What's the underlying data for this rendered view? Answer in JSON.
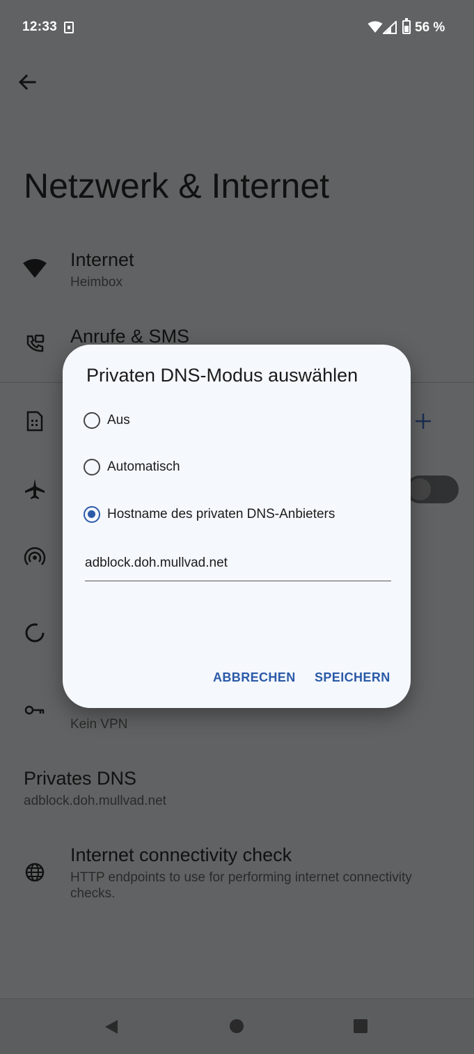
{
  "status_bar": {
    "time": "12:33",
    "battery": "56 %"
  },
  "page": {
    "title": "Netzwerk & Internet"
  },
  "settings": {
    "internet": {
      "title": "Internet",
      "subtitle": "Heimbox"
    },
    "calls": {
      "title": "Anrufe & SMS"
    },
    "vpn": {
      "subtitle": "Kein VPN"
    },
    "private_dns": {
      "title": "Privates DNS",
      "subtitle": "adblock.doh.mullvad.net"
    },
    "connectivity": {
      "title": "Internet connectivity check",
      "subtitle_line1": "HTTP endpoints to use for performing internet connectivity",
      "subtitle_line2": "checks."
    }
  },
  "dialog": {
    "title": "Privaten DNS-Modus auswählen",
    "options": [
      {
        "label": "Aus",
        "selected": false
      },
      {
        "label": "Automatisch",
        "selected": false
      },
      {
        "label": "Hostname des privaten DNS-Anbieters",
        "selected": true
      }
    ],
    "hostname_value": "adblock.doh.mullvad.net",
    "cancel_label": "ABBRECHEN",
    "save_label": "SPEICHERN"
  },
  "colors": {
    "accent": "#2b5aa8",
    "scrim": "#616263",
    "dialog_bg": "#f5f8fd"
  }
}
